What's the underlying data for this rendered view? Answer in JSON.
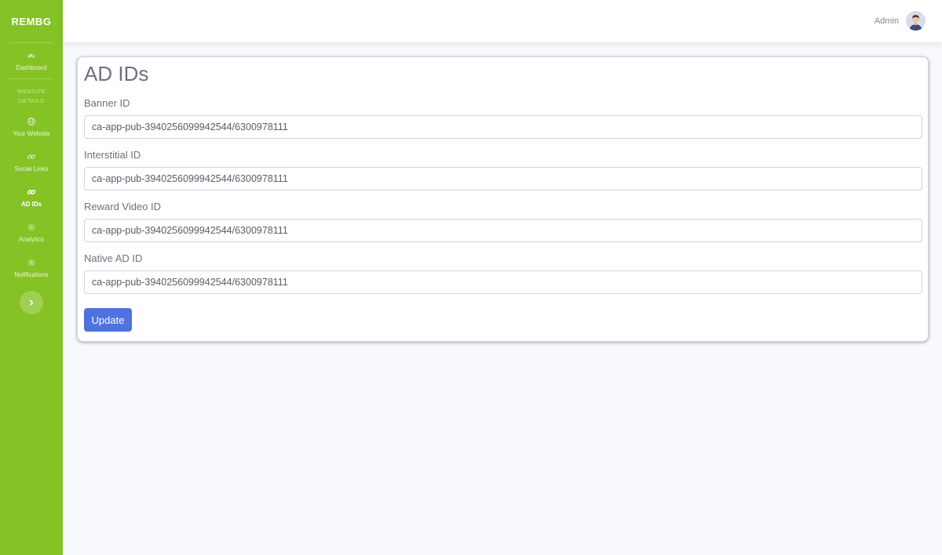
{
  "sidebar": {
    "brand": "REMBG",
    "items": [
      {
        "label": "Dashboard",
        "icon": "dashboard-icon"
      },
      {
        "label": "Your Website",
        "icon": "globe-icon"
      },
      {
        "label": "Social Links",
        "icon": "link-icon"
      },
      {
        "label": "AD IDs",
        "icon": "link-icon",
        "active": true
      },
      {
        "label": "Analytics",
        "icon": "gear-icon"
      },
      {
        "label": "Notifications",
        "icon": "gear-icon"
      }
    ],
    "heading_line1": "WEBSITE",
    "heading_line2": "DETAILS",
    "toggle_icon": "chevron-right-icon"
  },
  "topbar": {
    "user_name": "Admin"
  },
  "page": {
    "title": "AD IDs",
    "fields": [
      {
        "label": "Banner ID",
        "value": "ca-app-pub-3940256099942544/6300978111"
      },
      {
        "label": "Interstitial ID",
        "value": "ca-app-pub-3940256099942544/6300978111"
      },
      {
        "label": "Reward Video ID",
        "value": "ca-app-pub-3940256099942544/6300978111"
      },
      {
        "label": "Native AD ID",
        "value": "ca-app-pub-3940256099942544/6300978111"
      }
    ],
    "update_label": "Update"
  },
  "colors": {
    "sidebar": "#84c225",
    "primary": "#4e73df",
    "background": "#f8f9fc"
  }
}
